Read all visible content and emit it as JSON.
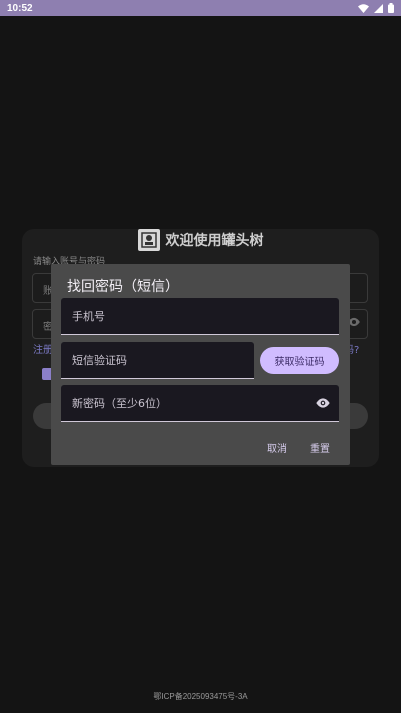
{
  "status_bar": {
    "time": "10:52",
    "icons": [
      "wifi-icon",
      "signal-icon",
      "battery-icon"
    ]
  },
  "login": {
    "title": "欢迎使用罐头树",
    "hint": "请输入账号与密码",
    "account_placeholder": "账",
    "password_placeholder": "密",
    "register_link": "注册",
    "forgot_link": "码?"
  },
  "dialog": {
    "title": "找回密码（短信）",
    "phone_placeholder": "手机号",
    "code_placeholder": "短信验证码",
    "get_code_label": "获取验证码",
    "new_password_placeholder": "新密码（至少6位）",
    "cancel_label": "取消",
    "reset_label": "重置"
  },
  "footer": {
    "icp": "鄂ICP备2025093475号-3A"
  },
  "colors": {
    "status_bar": "#8e7fb0",
    "accent": "#d0bcff",
    "dialog_bg": "#4a4a4a",
    "field_bg": "#1a1820"
  }
}
